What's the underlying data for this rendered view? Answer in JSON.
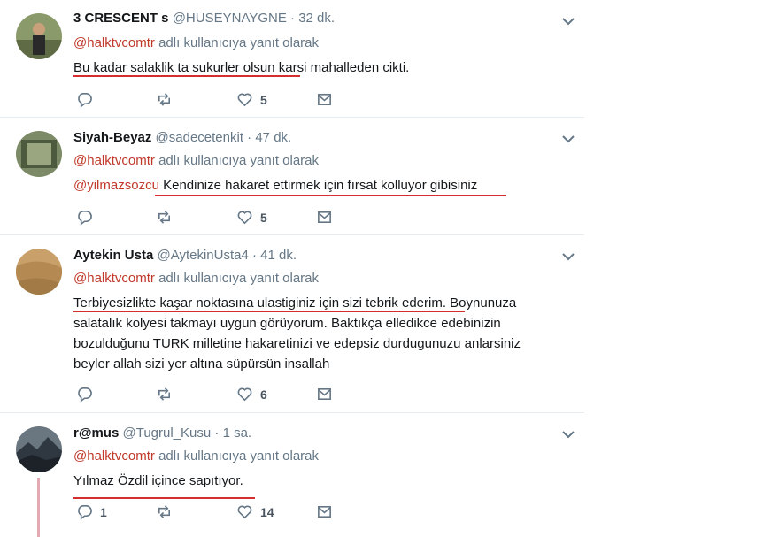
{
  "colors": {
    "mention": "#c0392b",
    "underline": "#d42e2e",
    "thread_line": "#e3aab3",
    "muted": "#657786"
  },
  "replying_suffix": " adlı kullanıcıya yanıt olarak",
  "tweets": [
    {
      "name": "3 CRESCENT s",
      "handle": "@HUSEYNAYGNE",
      "time": "32 dk.",
      "reply_to": "@halktvcomtr",
      "text": "Bu kadar salaklik ta sukurler olsun karsi mahalleden cikti.",
      "reply_count": "",
      "retweet_count": "",
      "like_count": "5"
    },
    {
      "name": "Siyah-Beyaz",
      "handle": "@sadecetenkit",
      "time": "47 dk.",
      "reply_to": "@halktvcomtr",
      "text_mention": "@yilmazsozcu",
      "text": "Kendinize hakaret ettirmek için fırsat kolluyor gibisiniz",
      "reply_count": "",
      "retweet_count": "",
      "like_count": "5"
    },
    {
      "name": "Aytekin Usta",
      "handle": "@AytekinUsta4",
      "time": "41 dk.",
      "reply_to": "@halktvcomtr",
      "text_lines": [
        "Terbiyesizlikte kaşar noktasına ulastiginiz için sizi tebrik ederim. Boynunuza",
        "salatalık kolyesi takmayı uygun görüyorum. Baktıkça elledikce edebinizin",
        "bozulduğunu TURK milletine hakaretinizi ve edepsiz durdugunuzu anlarsiniz",
        "beyler allah sizi yer altına süpürsün insallah"
      ],
      "reply_count": "",
      "retweet_count": "",
      "like_count": "6"
    },
    {
      "name": "r@mus",
      "handle": "@Tugrul_Kusu",
      "time": "1 sa.",
      "reply_to": "@halktvcomtr",
      "text": "Yılmaz Özdil içince sapıtıyor.",
      "reply_count": "1",
      "retweet_count": "",
      "like_count": "14"
    }
  ]
}
